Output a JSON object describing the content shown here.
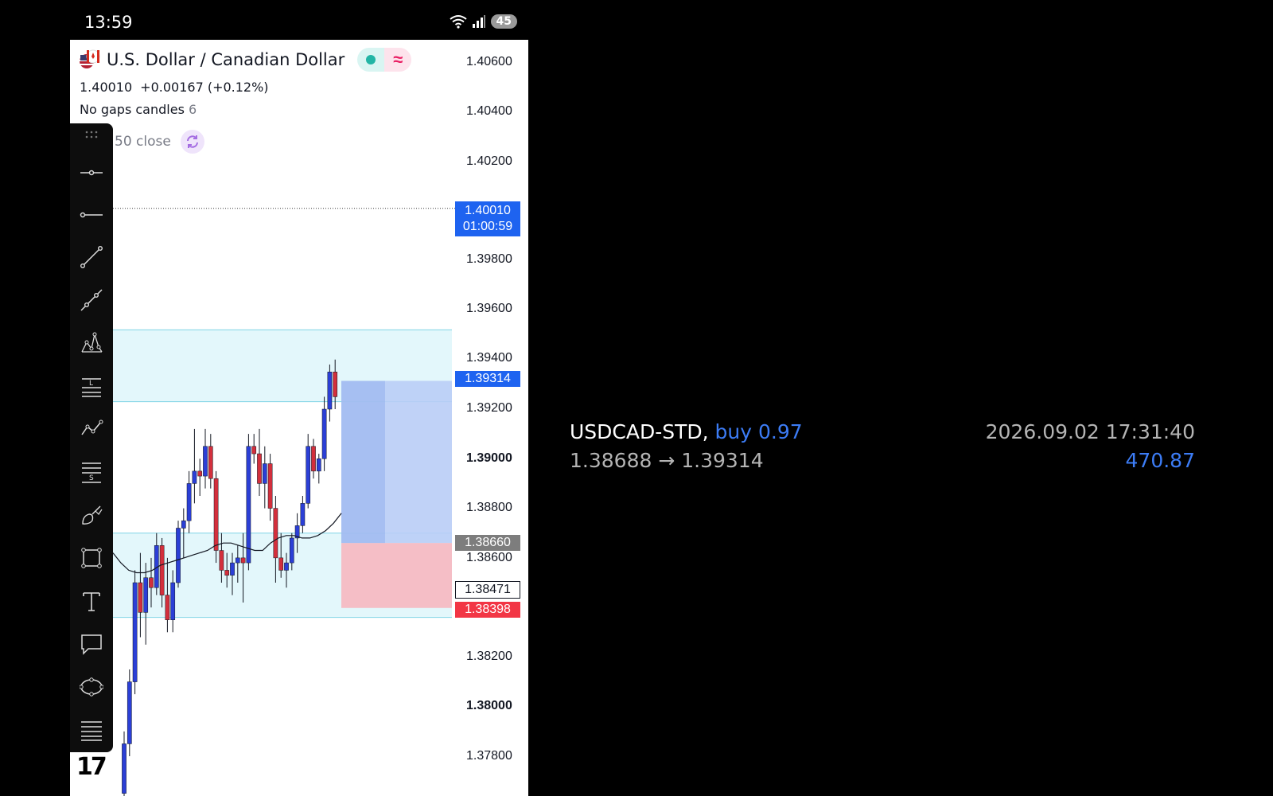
{
  "status_bar": {
    "time": "13:59",
    "battery": "45"
  },
  "header": {
    "symbol": "U.S. Dollar / Canadian Dollar",
    "price": "1.40010",
    "change": "+0.00167 (+0.12%)",
    "indicator_label": "No gaps candles",
    "indicator_value": "6",
    "ma_label": "50 close"
  },
  "axis": {
    "ticks": [
      "1.40600",
      "1.40400",
      "1.40200",
      "1.39800",
      "1.39600",
      "1.39400",
      "1.39200",
      "1.39000",
      "1.38800",
      "1.38600",
      "1.38200",
      "1.38000",
      "1.37800"
    ]
  },
  "tags": {
    "current_price": "1.40010",
    "countdown": "01:00:59",
    "target": "1.39314",
    "entry": "1.38660",
    "crosshair": "1.38471",
    "stop": "1.38398"
  },
  "toolbar": {
    "tools": [
      "drag-handle",
      "horizontal-line-icon",
      "horizontal-ray-icon",
      "trend-line-icon",
      "extended-line-icon",
      "pattern-icon",
      "long-position-icon",
      "forecast-icon",
      "short-position-icon",
      "brush-icon",
      "rectangle-icon",
      "text-icon",
      "callout-icon",
      "ellipse-icon",
      "fib-icon"
    ]
  },
  "overlay": {
    "symbol": "USDCAD-STD,",
    "action": "buy 0.97",
    "prices": "1.38688 → 1.39314",
    "datetime": "2026.09.02 17:31:40",
    "profit": "470.87"
  },
  "colors": {
    "bull_candle": "#2b3fd6",
    "bear_candle": "#d32f3c",
    "zone_fill": "#e3f7fb",
    "zone_line": "#7fd3e6",
    "profit_fill": "#b9cdf6",
    "loss_fill": "#f6b7c0"
  }
}
